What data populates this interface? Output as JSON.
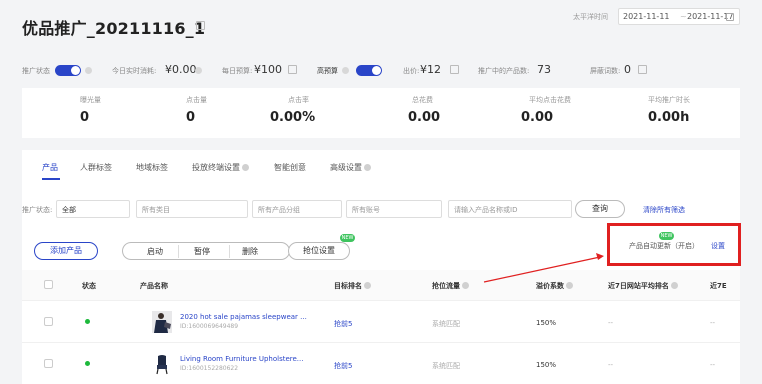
{
  "header": {
    "title": "优品推广_20211116_1",
    "date_label": "太平洋时间",
    "date_start": "2021-11-11",
    "date_sep": "~",
    "date_end": "2021-11-17"
  },
  "status": {
    "promo_state_label": "推广状态",
    "today_spend_label": "今日实时消耗:",
    "today_spend_value": "¥0.00",
    "daily_budget_label": "每日预算:",
    "daily_budget_value": "¥100",
    "high_budget_label": "高预算",
    "bid_label": "出价:",
    "bid_value": "¥12",
    "products_label": "推广中的产品数:",
    "products_value": "73",
    "blocked_words_label": "屏蔽词数:",
    "blocked_words_value": "0"
  },
  "metrics": [
    {
      "label": "曝光量",
      "value": "0"
    },
    {
      "label": "点击量",
      "value": "0"
    },
    {
      "label": "点击率",
      "value": "0.00%"
    },
    {
      "label": "总花费",
      "value": "0.00"
    },
    {
      "label": "平均点击花费",
      "value": "0.00"
    },
    {
      "label": "平均推广时长",
      "value": "0.00h"
    }
  ],
  "tabs": [
    "产品",
    "人群标签",
    "地域标签",
    "投放终端设置",
    "智能创意",
    "高级设置"
  ],
  "filters": {
    "state_label": "推广状态:",
    "state_value": "全部",
    "category": "所有类目",
    "group": "所有产品分组",
    "account": "所有账号",
    "search_placeholder": "请输入产品名称或ID",
    "query_label": "查询",
    "clear_label": "清除所有筛选"
  },
  "actions": {
    "add_product": "添加产品",
    "start": "启动",
    "pause": "暂停",
    "delete": "删除",
    "bid_setting": "抢位设置",
    "new_badge": "NEW",
    "auto_update": "产品自动更新（开启）",
    "settings": "设置"
  },
  "table": {
    "headers": [
      "状态",
      "产品名称",
      "目标排名",
      "抢位流量",
      "溢价系数",
      "近7日网站平均排名",
      "近7E"
    ],
    "rows": [
      {
        "name": "2020 hot sale pajamas sleepwear ...",
        "id": "ID:1600069649489",
        "rank": "抢前5",
        "traffic": "系统匹配",
        "premium": "150%",
        "avg_rank": "--",
        "last": "--"
      },
      {
        "name": "Living Room Furniture Upholstere...",
        "id": "ID:1600152280622",
        "rank": "抢前5",
        "traffic": "系统匹配",
        "premium": "150%",
        "avg_rank": "--",
        "last": "--"
      }
    ]
  },
  "colors": {
    "accent": "#2a45c8",
    "status_active": "#1db93b",
    "highlight": "#e02020",
    "new_badge": "#3fc45f"
  }
}
